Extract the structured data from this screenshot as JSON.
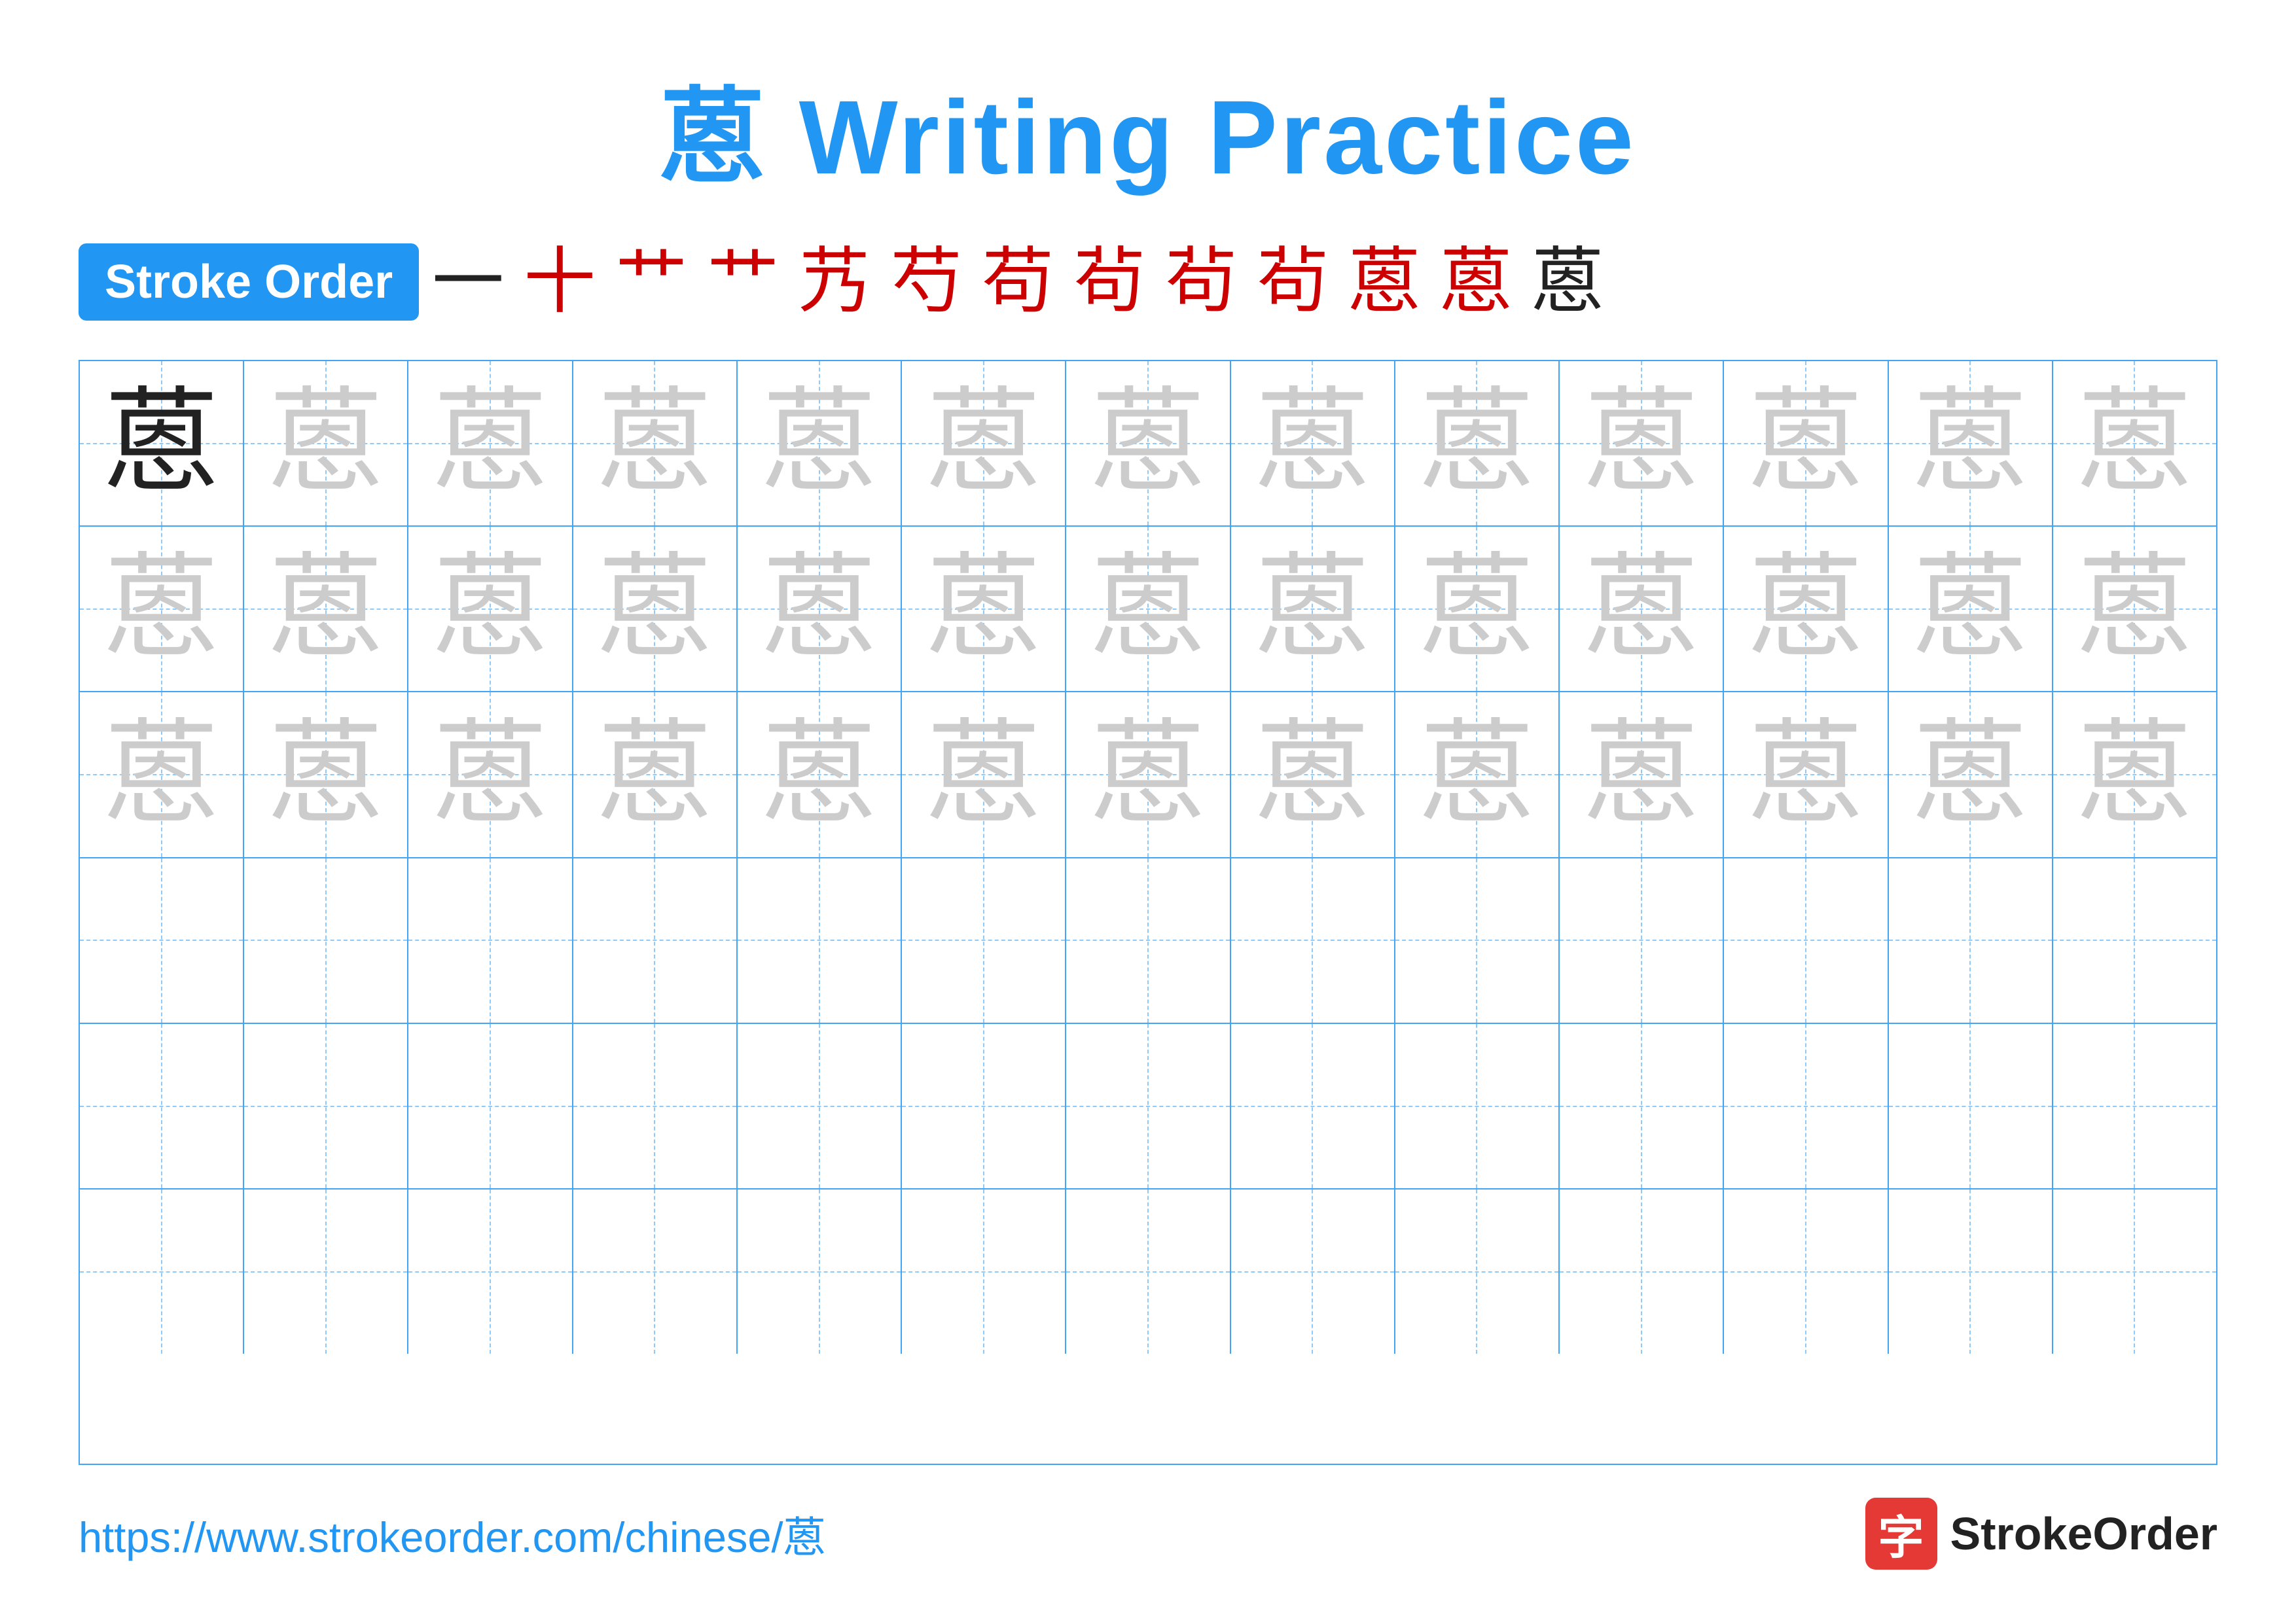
{
  "title": "蒽 Writing Practice",
  "stroke_order_label": "Stroke Order",
  "stroke_sequence": [
    "一",
    "十",
    "艹",
    "艹",
    "艿",
    "芍",
    "苟",
    "茍",
    "茍",
    "茍",
    "蒽",
    "蒽",
    "蒽"
  ],
  "character": "蒽",
  "rows": [
    {
      "cells": [
        {
          "type": "dark"
        },
        {
          "type": "light"
        },
        {
          "type": "light"
        },
        {
          "type": "light"
        },
        {
          "type": "light"
        },
        {
          "type": "light"
        },
        {
          "type": "light"
        },
        {
          "type": "light"
        },
        {
          "type": "light"
        },
        {
          "type": "light"
        },
        {
          "type": "light"
        },
        {
          "type": "light"
        },
        {
          "type": "light"
        }
      ]
    },
    {
      "cells": [
        {
          "type": "light"
        },
        {
          "type": "light"
        },
        {
          "type": "light"
        },
        {
          "type": "light"
        },
        {
          "type": "light"
        },
        {
          "type": "light"
        },
        {
          "type": "light"
        },
        {
          "type": "light"
        },
        {
          "type": "light"
        },
        {
          "type": "light"
        },
        {
          "type": "light"
        },
        {
          "type": "light"
        },
        {
          "type": "light"
        }
      ]
    },
    {
      "cells": [
        {
          "type": "light"
        },
        {
          "type": "light"
        },
        {
          "type": "light"
        },
        {
          "type": "light"
        },
        {
          "type": "light"
        },
        {
          "type": "light"
        },
        {
          "type": "light"
        },
        {
          "type": "light"
        },
        {
          "type": "light"
        },
        {
          "type": "light"
        },
        {
          "type": "light"
        },
        {
          "type": "light"
        },
        {
          "type": "light"
        }
      ]
    },
    {
      "cells": [
        {
          "type": "empty"
        },
        {
          "type": "empty"
        },
        {
          "type": "empty"
        },
        {
          "type": "empty"
        },
        {
          "type": "empty"
        },
        {
          "type": "empty"
        },
        {
          "type": "empty"
        },
        {
          "type": "empty"
        },
        {
          "type": "empty"
        },
        {
          "type": "empty"
        },
        {
          "type": "empty"
        },
        {
          "type": "empty"
        },
        {
          "type": "empty"
        }
      ]
    },
    {
      "cells": [
        {
          "type": "empty"
        },
        {
          "type": "empty"
        },
        {
          "type": "empty"
        },
        {
          "type": "empty"
        },
        {
          "type": "empty"
        },
        {
          "type": "empty"
        },
        {
          "type": "empty"
        },
        {
          "type": "empty"
        },
        {
          "type": "empty"
        },
        {
          "type": "empty"
        },
        {
          "type": "empty"
        },
        {
          "type": "empty"
        },
        {
          "type": "empty"
        }
      ]
    },
    {
      "cells": [
        {
          "type": "empty"
        },
        {
          "type": "empty"
        },
        {
          "type": "empty"
        },
        {
          "type": "empty"
        },
        {
          "type": "empty"
        },
        {
          "type": "empty"
        },
        {
          "type": "empty"
        },
        {
          "type": "empty"
        },
        {
          "type": "empty"
        },
        {
          "type": "empty"
        },
        {
          "type": "empty"
        },
        {
          "type": "empty"
        },
        {
          "type": "empty"
        }
      ]
    }
  ],
  "footer": {
    "url": "https://www.strokeorder.com/chinese/蒽",
    "logo_text": "StrokeOrder",
    "logo_char": "字"
  }
}
